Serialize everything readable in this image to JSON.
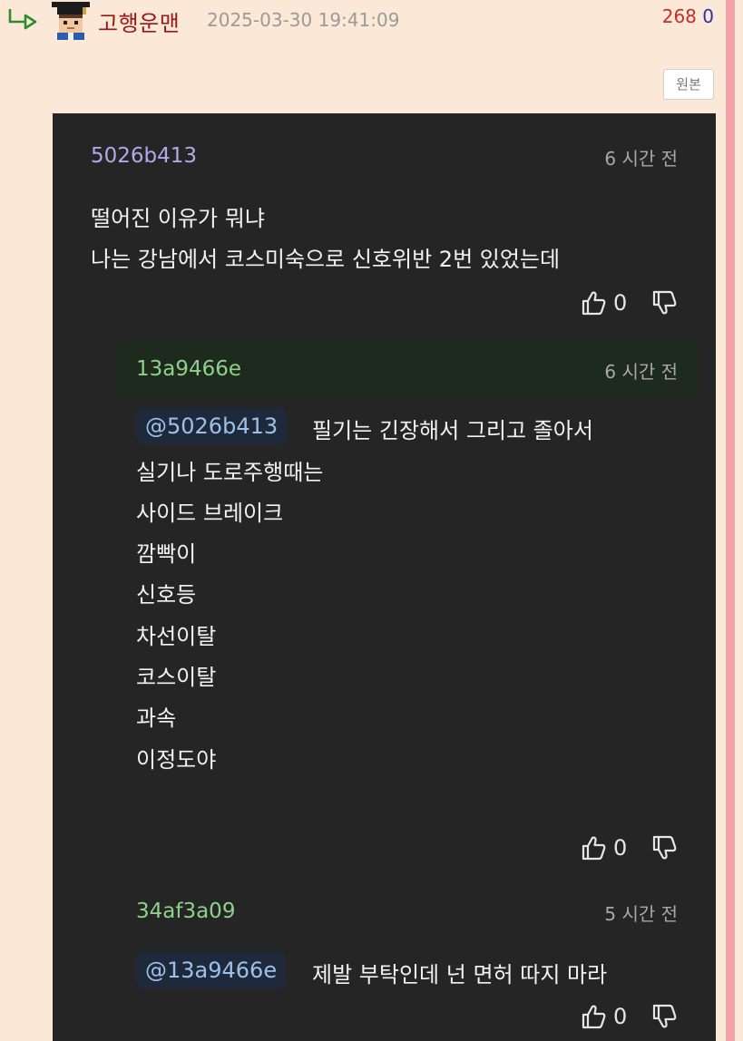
{
  "header": {
    "author": "고행운맨",
    "timestamp": "2025-03-30 19:41:09",
    "upvotes": "268",
    "downvotes": "0",
    "original_button": "원본"
  },
  "screenshot": {
    "comment": {
      "user": "5026b413",
      "time": "6 시간 전",
      "lines": [
        "떨어진 이유가 뭐냐",
        "나는 강남에서 코스미숙으로 신호위반 2번 있었는데"
      ],
      "likes": "0"
    },
    "reply1": {
      "user": "13a9466e",
      "time": "6 시간 전",
      "mention": "@5026b413",
      "first_line": "필기는 긴장해서 그리고 졸아서",
      "lines": [
        "실기나 도로주행때는",
        "사이드 브레이크",
        "깜빡이",
        "신호등",
        "차선이탈",
        "코스이탈",
        "과속",
        "이정도야"
      ],
      "likes": "0"
    },
    "reply2": {
      "user": "34af3a09",
      "time": "5 시간 전",
      "mention": "@13a9466e",
      "text": "제발 부탁인데 넌 면허 따지 마라",
      "likes": "0"
    }
  },
  "colors": {
    "page_bg": "#fbe8d6",
    "author": "#9a1616",
    "upvote": "#c72b2b",
    "downvote": "#2c2fa8",
    "dark_bg": "#252525",
    "user_purple": "#b3a8e8",
    "user_green": "#8fd08a",
    "mention": "#9cc0e8"
  },
  "icons": [
    "reply-arrow-icon",
    "avatar-icon",
    "thumbs-up-icon",
    "thumbs-down-icon"
  ]
}
